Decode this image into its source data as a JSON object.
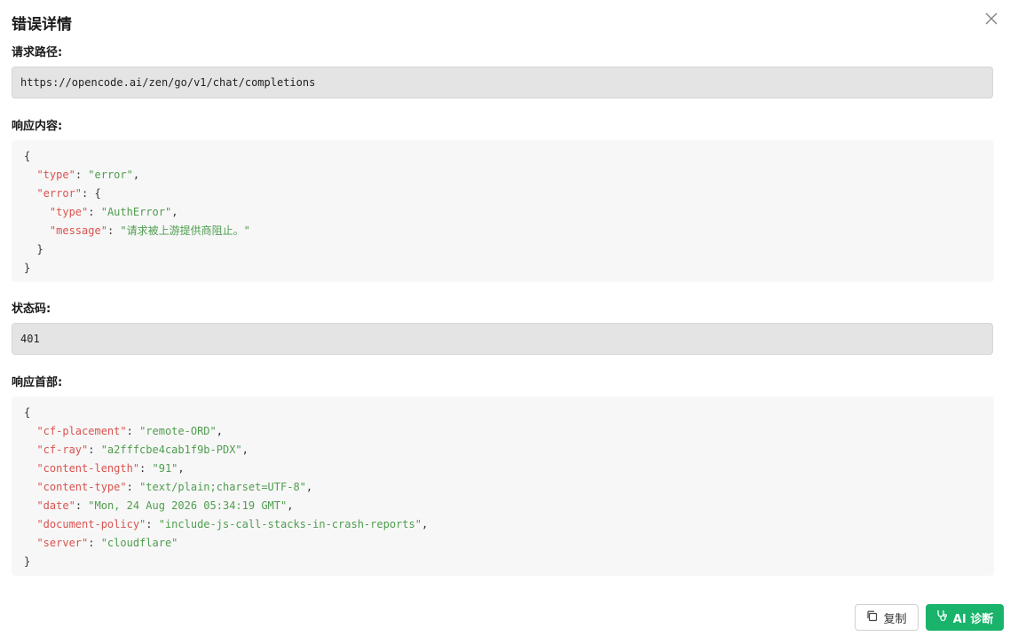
{
  "dialog": {
    "title": "错误详情",
    "close_icon": "close-icon"
  },
  "request_path": {
    "label": "请求路径:",
    "value": "https://opencode.ai/zen/go/v1/chat/completions"
  },
  "response_body": {
    "label": "响应内容:",
    "lines": [
      {
        "text": "{"
      },
      {
        "key": "\"type\"",
        "value": "\"error\"",
        "suffix": ",",
        "indent": 1
      },
      {
        "key": "\"error\"",
        "value": "",
        "suffix": "{",
        "indent": 1
      },
      {
        "key": "\"type\"",
        "value": "\"AuthError\"",
        "suffix": ",",
        "indent": 2
      },
      {
        "key": "\"message\"",
        "value": "\"请求被上游提供商阻止。\"",
        "suffix": "",
        "indent": 2
      },
      {
        "text": "}",
        "indent": 1
      },
      {
        "text": "}"
      }
    ]
  },
  "status_code": {
    "label": "状态码:",
    "value": "401"
  },
  "response_headers": {
    "label": "响应首部:",
    "lines": [
      {
        "text": "{"
      },
      {
        "key": "\"cf-placement\"",
        "value": "\"remote-ORD\"",
        "suffix": ",",
        "indent": 1
      },
      {
        "key": "\"cf-ray\"",
        "value": "\"a2fffcbe4cab1f9b-PDX\"",
        "suffix": ",",
        "indent": 1
      },
      {
        "key": "\"content-length\"",
        "value": "\"91\"",
        "suffix": ",",
        "indent": 1
      },
      {
        "key": "\"content-type\"",
        "value": "\"text/plain;charset=UTF-8\"",
        "suffix": ",",
        "indent": 1
      },
      {
        "key": "\"date\"",
        "value": "\"Mon, 24 Aug 2026 05:34:19 GMT\"",
        "suffix": ",",
        "indent": 1
      },
      {
        "key": "\"document-policy\"",
        "value": "\"include-js-call-stacks-in-crash-reports\"",
        "suffix": ",",
        "indent": 1
      },
      {
        "key": "\"server\"",
        "value": "\"cloudflare\"",
        "suffix": "",
        "indent": 1
      },
      {
        "text": "}"
      }
    ]
  },
  "footer": {
    "copy_label": "复制",
    "copy_icon": "copy-icon",
    "ai_label": "AI 诊断",
    "ai_icon": "stethoscope-icon",
    "ai_color": "#19b36b"
  },
  "colors": {
    "json_key": "#d9534f",
    "json_string": "#4f9d4f"
  }
}
